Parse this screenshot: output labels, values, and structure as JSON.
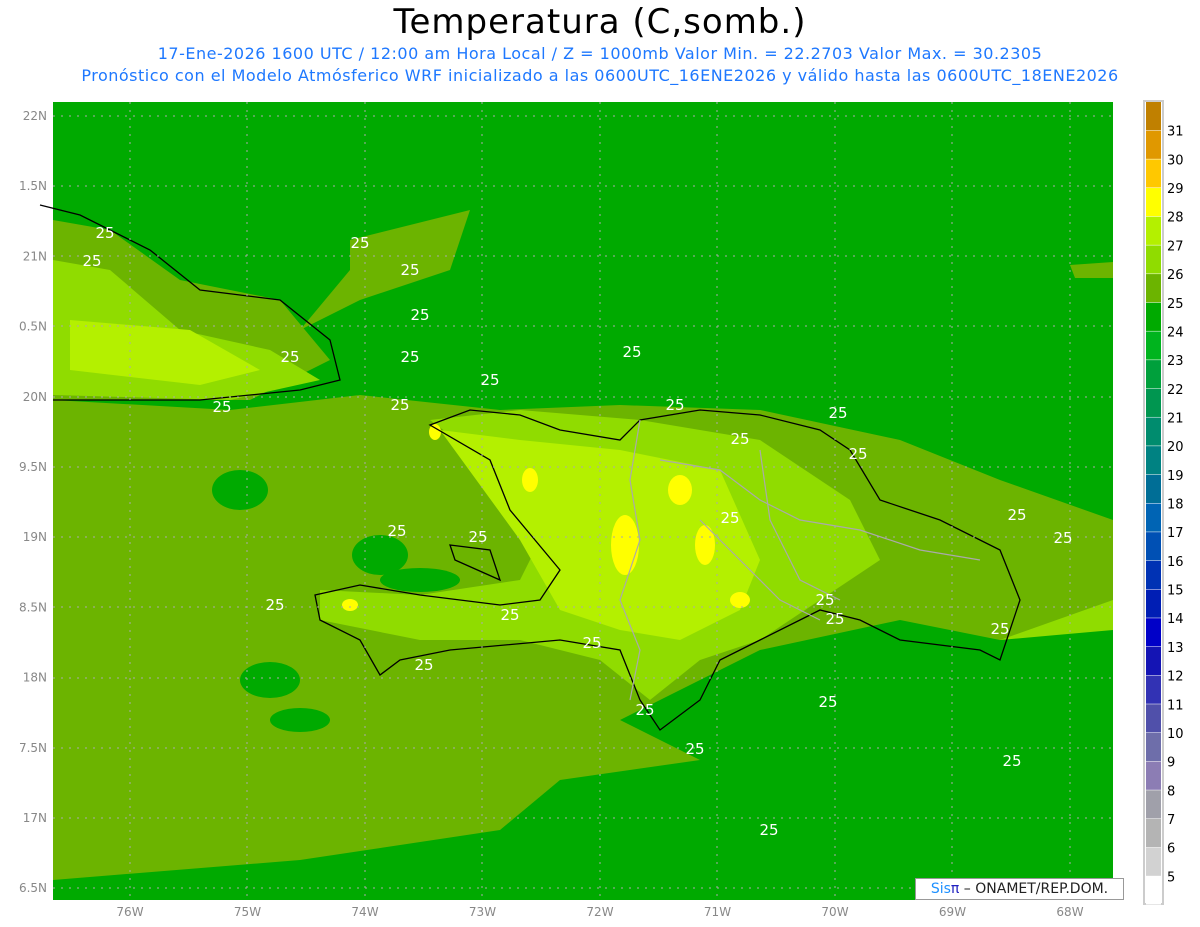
{
  "title": "Temperatura (C,somb.)",
  "subtitle1": "17-Ene-2026 1600 UTC / 12:00 am Hora Local / Z = 1000mb  Valor Min. = 22.2703  Valor Max. = 30.2305",
  "subtitle2": "Pronóstico con el Modelo Atmósferico WRF inicializado a las 0600UTC_16ENE2026 y válido hasta las  0600UTC_18ENE2026",
  "lat_labels": [
    "22N",
    "1.5N",
    "21N",
    "0.5N",
    "20N",
    "9.5N",
    "19N",
    "8.5N",
    "18N",
    "7.5N",
    "17N",
    "6.5N"
  ],
  "lon_labels": [
    "76W",
    "75W",
    "74W",
    "73W",
    "72W",
    "71W",
    "70W",
    "69W",
    "68W"
  ],
  "colorbar": {
    "labels": [
      "31",
      "30",
      "29",
      "28",
      "27",
      "26",
      "25",
      "24",
      "23",
      "22",
      "21",
      "20",
      "19",
      "18",
      "17",
      "16",
      "15",
      "14",
      "13",
      "12",
      "11",
      "10",
      "9",
      "8",
      "7",
      "6",
      "5"
    ],
    "colors": [
      "#c08000",
      "#e09800",
      "#ffc800",
      "#ffff00",
      "#b4f000",
      "#90dc00",
      "#6cb400",
      "#00aa00",
      "#00b41e",
      "#00a03c",
      "#009650",
      "#008c6e",
      "#008282",
      "#006e96",
      "#0064b4",
      "#0050b4",
      "#0032b4",
      "#001eb4",
      "#0000c8",
      "#1414b4",
      "#3232b4",
      "#5050aa",
      "#6e6eaa",
      "#8c7db4",
      "#a0a0aa",
      "#b4b4b4",
      "#d2d2d2",
      "#ffffff"
    ]
  },
  "contour_label": "25",
  "credit": {
    "sis": "Sis",
    "pi": "π",
    "rest": " – ONAMET/REP.DOM."
  }
}
